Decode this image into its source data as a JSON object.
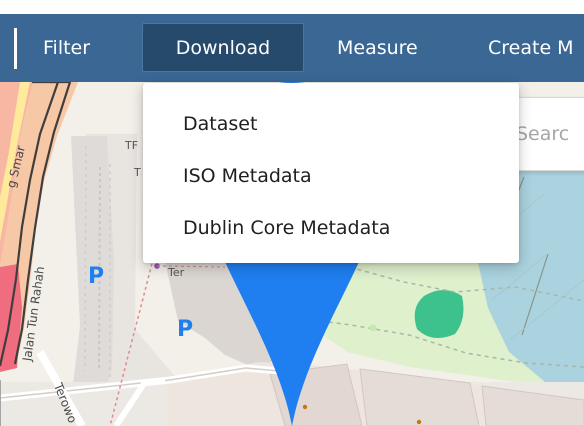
{
  "toolbar": {
    "items": [
      {
        "label": "Filter"
      },
      {
        "label": "Download"
      },
      {
        "label": "Measure"
      },
      {
        "label": "Create M"
      }
    ]
  },
  "download_menu": {
    "items": [
      {
        "label": "Dataset"
      },
      {
        "label": "ISO Metadata"
      },
      {
        "label": "Dublin Core Metadata"
      }
    ]
  },
  "search": {
    "placeholder": "Searc"
  },
  "map": {
    "road_labels": [
      {
        "text": "g Smar"
      },
      {
        "text": "Jalan Tun Rahah"
      },
      {
        "text": "Terowo"
      }
    ],
    "place_labels": [
      {
        "text": "Ter"
      },
      {
        "text": "T"
      },
      {
        "text": "TF"
      }
    ],
    "parking_labels": [
      {
        "text": "P"
      },
      {
        "text": "P"
      }
    ]
  },
  "colors": {
    "toolbar": "#3a6794",
    "active_tab": "#254a6c",
    "map_background": "#f3efe9",
    "park": "#dff0cd",
    "water": "#aad3df",
    "marker": "#1f7ff0"
  }
}
